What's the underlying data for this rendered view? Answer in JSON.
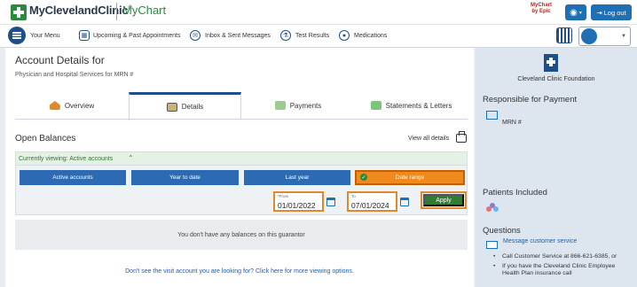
{
  "header": {
    "brand": "MyClevelandClinic",
    "brand_mark": "®",
    "app": "MyChart",
    "epic_line1": "MyChart",
    "epic_line2": "by Epic",
    "logout_label": "Log out"
  },
  "nav": {
    "menu_label": "Your Menu",
    "items": [
      {
        "label": "Upcoming & Past Appointments"
      },
      {
        "label": "Inbox & Sent Messages"
      },
      {
        "label": "Test Results"
      },
      {
        "label": "Medications"
      }
    ]
  },
  "main": {
    "title": "Account Details for",
    "subtitle": "Physician and Hospital Services for MRN #",
    "tabs": [
      {
        "label": "Overview",
        "active": false
      },
      {
        "label": "Details",
        "active": true
      },
      {
        "label": "Payments",
        "active": false
      },
      {
        "label": "Statements & Letters",
        "active": false
      }
    ],
    "open_balances_title": "Open Balances",
    "view_all_details": "View all details",
    "currently_viewing": "Currently viewing: Active accounts",
    "filters": [
      {
        "label": "Active accounts",
        "active": false
      },
      {
        "label": "Year to date",
        "active": false
      },
      {
        "label": "Last year",
        "active": false
      },
      {
        "label": "Date range",
        "active": true
      }
    ],
    "from_label": "From",
    "from_value": "01/01/2022",
    "to_label": "To",
    "to_value": "07/01/2024",
    "apply_label": "Apply",
    "empty_message": "You don't have any balances on this guarantor",
    "more_link": "Don't see the visit account you are looking for? Click here for more viewing options."
  },
  "side": {
    "org_name": "Cleveland Clinic Foundation",
    "responsible_title": "Responsible for Payment",
    "mrn": "MRN #",
    "patients_title": "Patients Included",
    "questions_title": "Questions",
    "message_link": "Message customer service",
    "bullets": [
      "Call Customer Service at 866-621-6385, or",
      "If you have the Cleveland Clinic Employee Health Plan insurance call"
    ]
  },
  "colors": {
    "primary": "#1f4f8a",
    "button_blue": "#2c6bb3",
    "active_orange": "#f08a1c",
    "apply_green": "#2e7d32",
    "brand_green": "#2b8a3e"
  }
}
